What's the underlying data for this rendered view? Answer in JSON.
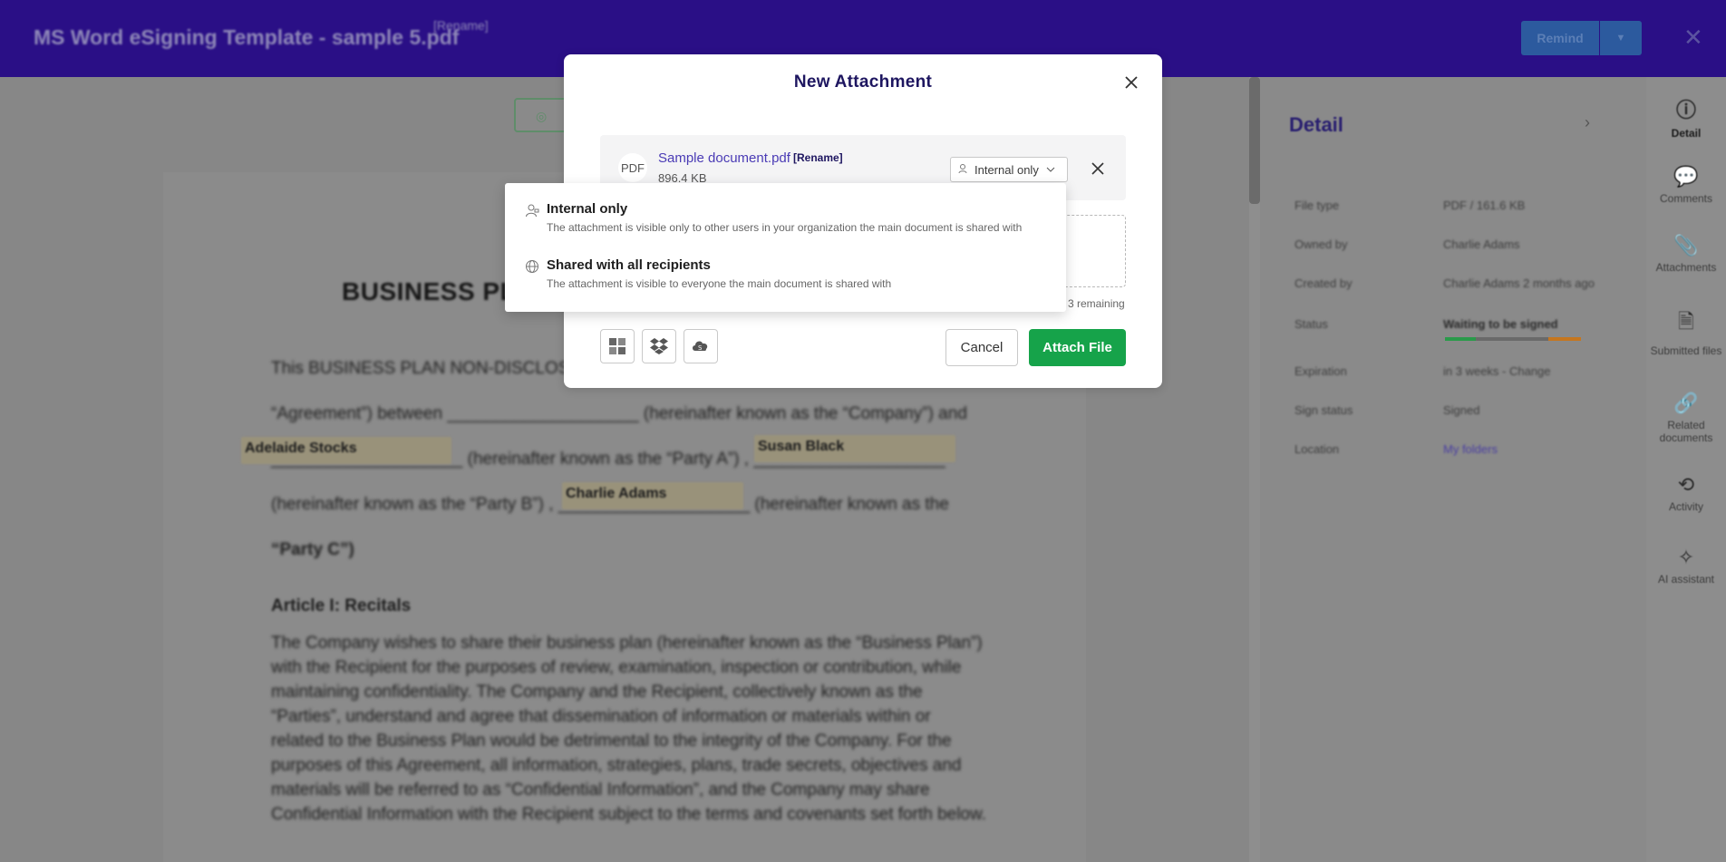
{
  "header": {
    "doc_title": "MS Word eSigning Template - sample 5.pdf",
    "rename": "[Rename]",
    "remind": "Remind"
  },
  "document": {
    "heading": "BUSINESS PLA",
    "lines": [
      "This BUSINESS PLAN NON-DISCLOSU",
      "“Agreement”) between ____________________ (hereinafter known as the “Company”) and",
      "____________________ (hereinafter known as the “Party A”) , ____________________",
      "(hereinafter known as the “Party B”) , ____________________ (hereinafter known as the",
      "“Party C”)"
    ],
    "fields": {
      "party_a": "Adelaide Stocks",
      "party_b": "Susan Black",
      "party_c": "Charlie Adams"
    },
    "article": "Article I: Recitals",
    "paragraph": "The Company wishes to share their business plan (hereinafter known as the “Business Plan”) with the Recipient for the purposes of review, examination, inspection or contribution, while maintaining confidentiality. The Company and the Recipient, collectively known as the “Parties”, understand and agree that dissemination of information or materials within or related to the Business Plan would be detrimental to the integrity of the Company. For the purposes of this Agreement, all information, strategies, plans, trade secrets, objectives and materials will be referred to as “Confidential Information”, and the Company may share Confidential Information with the Recipient subject to the terms and covenants set forth below."
  },
  "detail": {
    "title": "Detail",
    "rows": [
      {
        "key": "File type",
        "value": "PDF / 161.6 KB"
      },
      {
        "key": "Owned by",
        "value": "Charlie Adams"
      },
      {
        "key": "Created by",
        "value": "Charlie Adams 2 months ago"
      },
      {
        "key": "Status",
        "value": "Waiting to be signed"
      },
      {
        "key": "Expiration",
        "value": "in 3 weeks - Change"
      },
      {
        "key": "Sign status",
        "value": "Signed"
      },
      {
        "key": "Location",
        "value": "My folders"
      }
    ],
    "status_colors": [
      "#2a9a4a",
      "#6a6a6a",
      "#6a6a6a",
      "#6a6a6a",
      "#c5761f"
    ]
  },
  "rail": [
    {
      "label": "Detail",
      "icon": "info-icon"
    },
    {
      "label": "Comments",
      "icon": "comment-icon"
    },
    {
      "label": "Attachments",
      "icon": "paperclip-icon"
    },
    {
      "label": "Submitted files",
      "icon": "file-upload-icon"
    },
    {
      "label": "Related documents",
      "icon": "link-icon"
    },
    {
      "label": "Activity",
      "icon": "history-icon"
    },
    {
      "label": "AI assistant",
      "icon": "magic-wand-icon"
    }
  ],
  "modal": {
    "title": "New Attachment",
    "file": {
      "type": "PDF",
      "name": "Sample document.pdf",
      "rename": "[Rename]",
      "size": "896.4 KB",
      "visibility": "Internal only"
    },
    "remaining": "3 remaining",
    "sources": [
      "windows-icon",
      "dropbox-icon",
      "cloud-drive-icon"
    ],
    "cancel": "Cancel",
    "attach": "Attach File"
  },
  "dropdown": {
    "options": [
      {
        "label": "Internal only",
        "description": "The attachment is visible only to other users in your organization the main document is shared with",
        "icon": "user-lock-icon"
      },
      {
        "label": "Shared with all recipients",
        "description": "The attachment is visible to everyone the main document is shared with",
        "icon": "globe-icon"
      }
    ]
  },
  "colors": {
    "brand": "#2a0f86",
    "accent": "#4a3bb5",
    "primary_action": "#16a34a"
  }
}
